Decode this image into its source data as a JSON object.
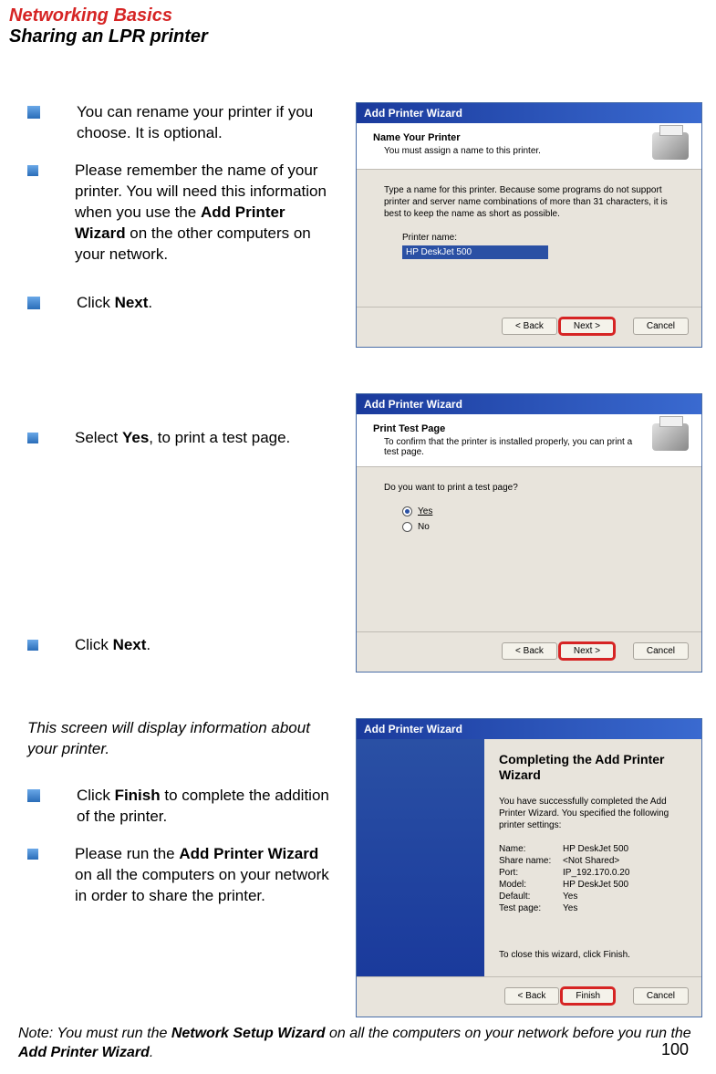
{
  "header": {
    "title_red": "Networking Basics",
    "title_black": "Sharing an LPR printer"
  },
  "section1": {
    "bullets": [
      {
        "text": "You can rename your printer if you choose.  It is optional.",
        "italic": false
      },
      {
        "text_pre": "Please remember the name of your printer.  You will need this information when you use the ",
        "strong": "Add Printer Wizard",
        "text_post": " on the other computers on your network.",
        "italic": true
      },
      {
        "text_pre": "Click ",
        "strong": "Next",
        "text_post": ".",
        "italic": false
      }
    ],
    "wizard": {
      "title": "Add Printer Wizard",
      "header_title": "Name Your Printer",
      "header_sub": "You must assign a name to this printer.",
      "desc": "Type a name for this printer. Because some programs do not support printer and server name combinations of more than 31 characters, it is best to keep the name as short as possible.",
      "label": "Printer name:",
      "input_value": "HP DeskJet 500",
      "btn_back": "< Back",
      "btn_next": "Next >",
      "btn_cancel": "Cancel"
    }
  },
  "section2": {
    "bullets": [
      {
        "text_pre": "Select ",
        "strong": "Yes",
        "text_post": ", to print a test page."
      },
      {
        "text_pre": "Click ",
        "strong": "Next",
        "text_post": "."
      }
    ],
    "wizard": {
      "title": "Add Printer Wizard",
      "header_title": "Print Test Page",
      "header_sub": "To confirm that the printer is installed properly, you can print a test page.",
      "question": "Do you want to print a test page?",
      "opt_yes": "Yes",
      "opt_no": "No",
      "btn_back": "< Back",
      "btn_next": "Next >",
      "btn_cancel": "Cancel"
    }
  },
  "section3": {
    "info": "This screen will display information about your printer.",
    "bullets": [
      {
        "text_pre": "Click ",
        "strong": "Finish",
        "text_post": " to complete the addition of the printer."
      },
      {
        "text_pre": "Please run the ",
        "strong": "Add Printer Wizard",
        "text_post": " on all the computers on your network in order to share the printer."
      }
    ],
    "wizard": {
      "title": "Add Printer Wizard",
      "final_title": "Completing the Add Printer Wizard",
      "final_desc": "You have successfully completed the Add Printer Wizard. You specified the following printer settings:",
      "rows": [
        {
          "k": "Name:",
          "v": "HP DeskJet 500"
        },
        {
          "k": "Share name:",
          "v": "<Not Shared>"
        },
        {
          "k": "Port:",
          "v": "IP_192.170.0.20"
        },
        {
          "k": "Model:",
          "v": "HP DeskJet 500"
        },
        {
          "k": "Default:",
          "v": "Yes"
        },
        {
          "k": "Test page:",
          "v": "Yes"
        }
      ],
      "close_text": "To close this wizard, click Finish.",
      "btn_back": "< Back",
      "btn_finish": "Finish",
      "btn_cancel": "Cancel"
    }
  },
  "note": {
    "pre": "Note:  You must run the ",
    "strong1": "Network Setup Wizard",
    "mid": " on all the computers on your network before you run the ",
    "strong2": "Add Printer Wizard",
    "post": "."
  },
  "page_number": "100"
}
